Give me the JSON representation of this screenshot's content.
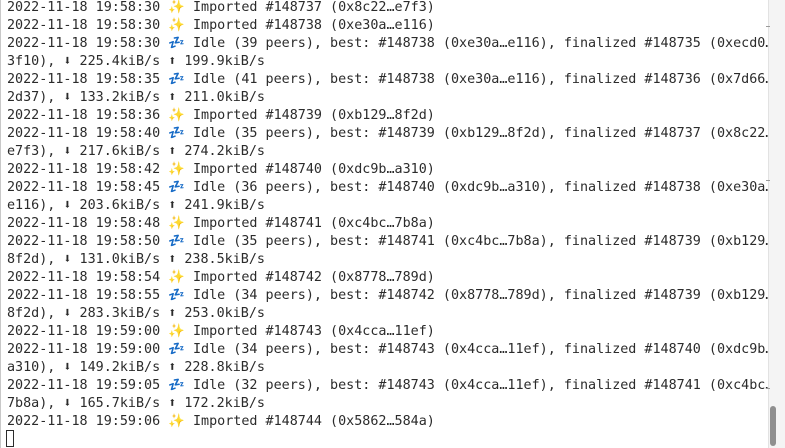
{
  "terminal": {
    "lines": [
      "2022-11-18 19:58:30 ✨ Imported #148737 (0x8c22…e7f3)",
      "2022-11-18 19:58:30 ✨ Imported #148738 (0xe30a…e116)",
      "2022-11-18 19:58:30 💤 Idle (39 peers), best: #148738 (0xe30a…e116), finalized #148735 (0xecd0…",
      "3f10), ⬇ 225.4kiB/s ⬆ 199.9kiB/s",
      "2022-11-18 19:58:35 💤 Idle (41 peers), best: #148738 (0xe30a…e116), finalized #148736 (0x7d66…",
      "2d37), ⬇ 133.2kiB/s ⬆ 211.0kiB/s",
      "2022-11-18 19:58:36 ✨ Imported #148739 (0xb129…8f2d)",
      "2022-11-18 19:58:40 💤 Idle (35 peers), best: #148739 (0xb129…8f2d), finalized #148737 (0x8c22…",
      "e7f3), ⬇ 217.6kiB/s ⬆ 274.2kiB/s",
      "2022-11-18 19:58:42 ✨ Imported #148740 (0xdc9b…a310)",
      "2022-11-18 19:58:45 💤 Idle (36 peers), best: #148740 (0xdc9b…a310), finalized #148738 (0xe30a…",
      "e116), ⬇ 203.6kiB/s ⬆ 241.9kiB/s",
      "2022-11-18 19:58:48 ✨ Imported #148741 (0xc4bc…7b8a)",
      "2022-11-18 19:58:50 💤 Idle (35 peers), best: #148741 (0xc4bc…7b8a), finalized #148739 (0xb129…",
      "8f2d), ⬇ 131.0kiB/s ⬆ 238.5kiB/s",
      "2022-11-18 19:58:54 ✨ Imported #148742 (0x8778…789d)",
      "2022-11-18 19:58:55 💤 Idle (34 peers), best: #148742 (0x8778…789d), finalized #148739 (0xb129…",
      "8f2d), ⬇ 283.3kiB/s ⬆ 253.0kiB/s",
      "2022-11-18 19:59:00 ✨ Imported #148743 (0x4cca…11ef)",
      "2022-11-18 19:59:00 💤 Idle (34 peers), best: #148743 (0x4cca…11ef), finalized #148740 (0xdc9b…",
      "a310), ⬇ 149.2kiB/s ⬆ 228.8kiB/s",
      "2022-11-18 19:59:05 💤 Idle (32 peers), best: #148743 (0x4cca…11ef), finalized #148741 (0xc4bc…",
      "7b8a), ⬇ 165.7kiB/s ⬆ 172.2kiB/s",
      "2022-11-18 19:59:06 ✨ Imported #148744 (0x5862…584a)"
    ]
  },
  "scrollbar": {
    "position_fraction": 0.95
  }
}
